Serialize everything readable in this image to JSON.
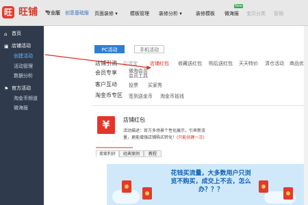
{
  "app": {
    "logo_glyph": "旺",
    "name": "旺铺",
    "caret": "▾",
    "edition": "专业版",
    "edition_link": "创意基础版"
  },
  "nav": {
    "items": [
      "页面装修 ▾",
      "模板管理",
      "装修分析 ▾",
      "装修模板",
      "微海报",
      "宝贝分类",
      "营销"
    ],
    "new_badge": "New"
  },
  "sidebar": {
    "home": "首页",
    "shop_activity": "店铺活动",
    "create_activity": "创建活动",
    "activity_manage": "活动管理",
    "data_analysis": "数据分析",
    "official_activity": "官方活动",
    "taojinbi_channel": "淘金币频道",
    "micro_poster": "微海报"
  },
  "tabs": {
    "pc": "PC活动",
    "mobile": "手机活动"
  },
  "rows": {
    "shop_lead": {
      "label": "店铺引流",
      "links": [
        "引流宝",
        "店铺红包",
        "收藏送红包",
        "购后送红包",
        "天天特价",
        "清仓活动",
        "商品优惠"
      ]
    },
    "member": {
      "label": "会员专享",
      "links": [
        "微淘会员",
        "会员工具"
      ]
    },
    "customer": {
      "label": "客户互动",
      "links": [
        "投票",
        "买家秀"
      ]
    },
    "taojinbi": {
      "label": "淘金币专区",
      "links": [
        "签到送金币",
        "淘金币抵钱"
      ]
    }
  },
  "card": {
    "icon": "¥",
    "title": "店铺红包",
    "desc_prefix": "活动描述：官方多场景个性化展示，引来新流量，更能增强店铺购买转化！",
    "desc_link": "(只能创建一次)"
  },
  "subtabs": [
    "卖家利好",
    "经典案例",
    "教程"
  ],
  "banner": {
    "text": "花钱买流量，大多数用户只浏览不购买，成交上不去，怎么办？？？"
  },
  "colors": {
    "brand_red": "#e63b2e",
    "accent_blue": "#2d7fd4",
    "sidebar_bg": "#2f3b4c"
  },
  "icons": {
    "home": "home-icon",
    "shop": "shop-icon",
    "official": "flag-icon",
    "active_pointer": "red-arrow"
  }
}
